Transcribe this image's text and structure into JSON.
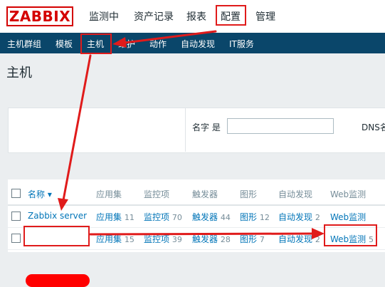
{
  "app": {
    "logo": "ZABBIX"
  },
  "main_menu": [
    "监测中",
    "资产记录",
    "报表",
    "配置",
    "管理"
  ],
  "sub_menu": [
    "主机群组",
    "模板",
    "主机",
    "维护",
    "动作",
    "自动发现",
    "IT服务"
  ],
  "page": {
    "title": "主机"
  },
  "filter": {
    "name_label": "名字 是",
    "name_value": "",
    "dns_label": "DNS名"
  },
  "table": {
    "headers": {
      "name": "名称 ▾",
      "applications": "应用集",
      "items": "监控项",
      "triggers": "触发器",
      "graphs": "图形",
      "discovery": "自动发现",
      "web": "Web监测"
    },
    "rows": [
      {
        "name": "Zabbix server",
        "applications": "应用集",
        "applications_count": "11",
        "items": "监控项",
        "items_count": "70",
        "triggers": "触发器",
        "triggers_count": "44",
        "graphs": "图形",
        "graphs_count": "12",
        "discovery": "自动发现",
        "discovery_count": "2",
        "web": "Web监测",
        "web_count": ""
      },
      {
        "name": "",
        "applications": "应用集",
        "applications_count": "15",
        "items": "监控项",
        "items_count": "39",
        "triggers": "触发器",
        "triggers_count": "28",
        "graphs": "图形",
        "graphs_count": "7",
        "discovery": "自动发现",
        "discovery_count": "2",
        "web": "Web监测",
        "web_count": "5"
      }
    ]
  },
  "colors": {
    "annotation_red": "#e01b1b",
    "subnav_bg": "#0a466a",
    "link": "#0275b8",
    "logo_red": "#d40000"
  }
}
